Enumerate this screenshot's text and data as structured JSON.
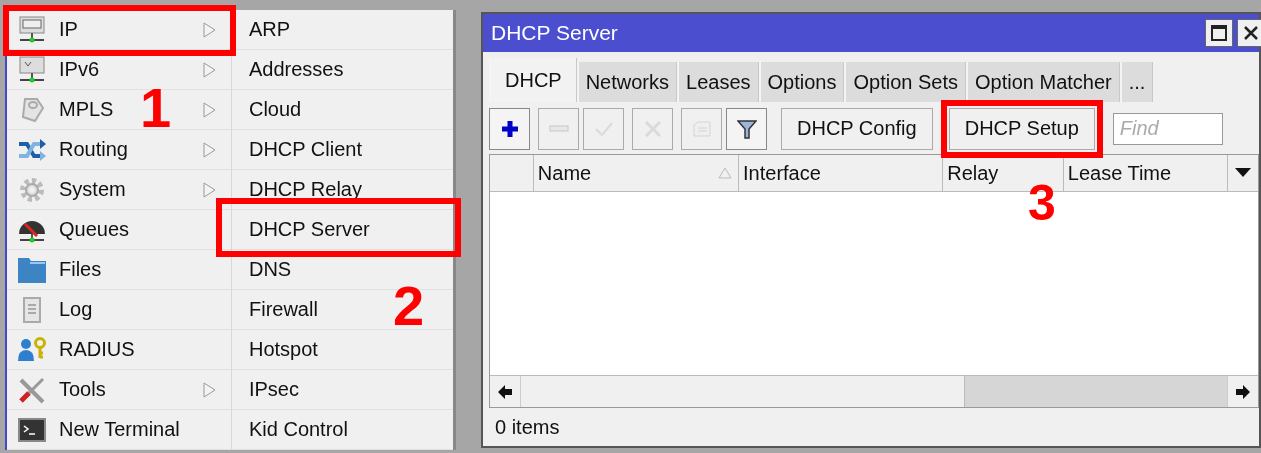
{
  "menu": {
    "items": [
      {
        "label": "IP",
        "has_submenu": true,
        "highlighted": true
      },
      {
        "label": "IPv6",
        "has_submenu": true,
        "highlighted": false
      },
      {
        "label": "MPLS",
        "has_submenu": true,
        "highlighted": false
      },
      {
        "label": "Routing",
        "has_submenu": true,
        "highlighted": false
      },
      {
        "label": "System",
        "has_submenu": true,
        "highlighted": false
      },
      {
        "label": "Queues",
        "has_submenu": false,
        "highlighted": false
      },
      {
        "label": "Files",
        "has_submenu": false,
        "highlighted": false
      },
      {
        "label": "Log",
        "has_submenu": false,
        "highlighted": false
      },
      {
        "label": "RADIUS",
        "has_submenu": false,
        "highlighted": false
      },
      {
        "label": "Tools",
        "has_submenu": true,
        "highlighted": false
      },
      {
        "label": "New Terminal",
        "has_submenu": false,
        "highlighted": false
      }
    ]
  },
  "submenu": {
    "items": [
      {
        "label": "ARP",
        "highlighted": false
      },
      {
        "label": "Addresses",
        "highlighted": false
      },
      {
        "label": "Cloud",
        "highlighted": false
      },
      {
        "label": "DHCP Client",
        "highlighted": false
      },
      {
        "label": "DHCP Relay",
        "highlighted": false
      },
      {
        "label": "DHCP Server",
        "highlighted": true
      },
      {
        "label": "DNS",
        "highlighted": false
      },
      {
        "label": "Firewall",
        "highlighted": false
      },
      {
        "label": "Hotspot",
        "highlighted": false
      },
      {
        "label": "IPsec",
        "highlighted": false
      },
      {
        "label": "Kid Control",
        "highlighted": false
      }
    ]
  },
  "window": {
    "title": "DHCP Server",
    "tabs": [
      {
        "label": "DHCP",
        "selected": true
      },
      {
        "label": "Networks",
        "selected": false
      },
      {
        "label": "Leases",
        "selected": false
      },
      {
        "label": "Options",
        "selected": false
      },
      {
        "label": "Option Sets",
        "selected": false
      },
      {
        "label": "Option Matcher",
        "selected": false
      },
      {
        "label": "...",
        "selected": false
      }
    ],
    "toolbar": {
      "icon_buttons": [
        {
          "kind": "add",
          "disabled": false
        },
        {
          "kind": "remove",
          "disabled": true
        },
        {
          "kind": "enable",
          "disabled": true
        },
        {
          "kind": "disable",
          "disabled": true
        },
        {
          "kind": "comment",
          "disabled": true
        },
        {
          "kind": "filter",
          "disabled": false
        }
      ],
      "buttons": [
        {
          "label": "DHCP Config",
          "highlighted": false
        },
        {
          "label": "DHCP Setup",
          "highlighted": true
        }
      ],
      "find": {
        "placeholder": "Find"
      }
    },
    "table": {
      "columns": [
        {
          "label": "Name",
          "sorted": true
        },
        {
          "label": "Interface",
          "sorted": false
        },
        {
          "label": "Relay",
          "sorted": false
        },
        {
          "label": "Lease Time",
          "sorted": false
        }
      ]
    },
    "status_bar": "0 items"
  },
  "callouts": [
    {
      "number": "1"
    },
    {
      "number": "2"
    },
    {
      "number": "3"
    }
  ]
}
